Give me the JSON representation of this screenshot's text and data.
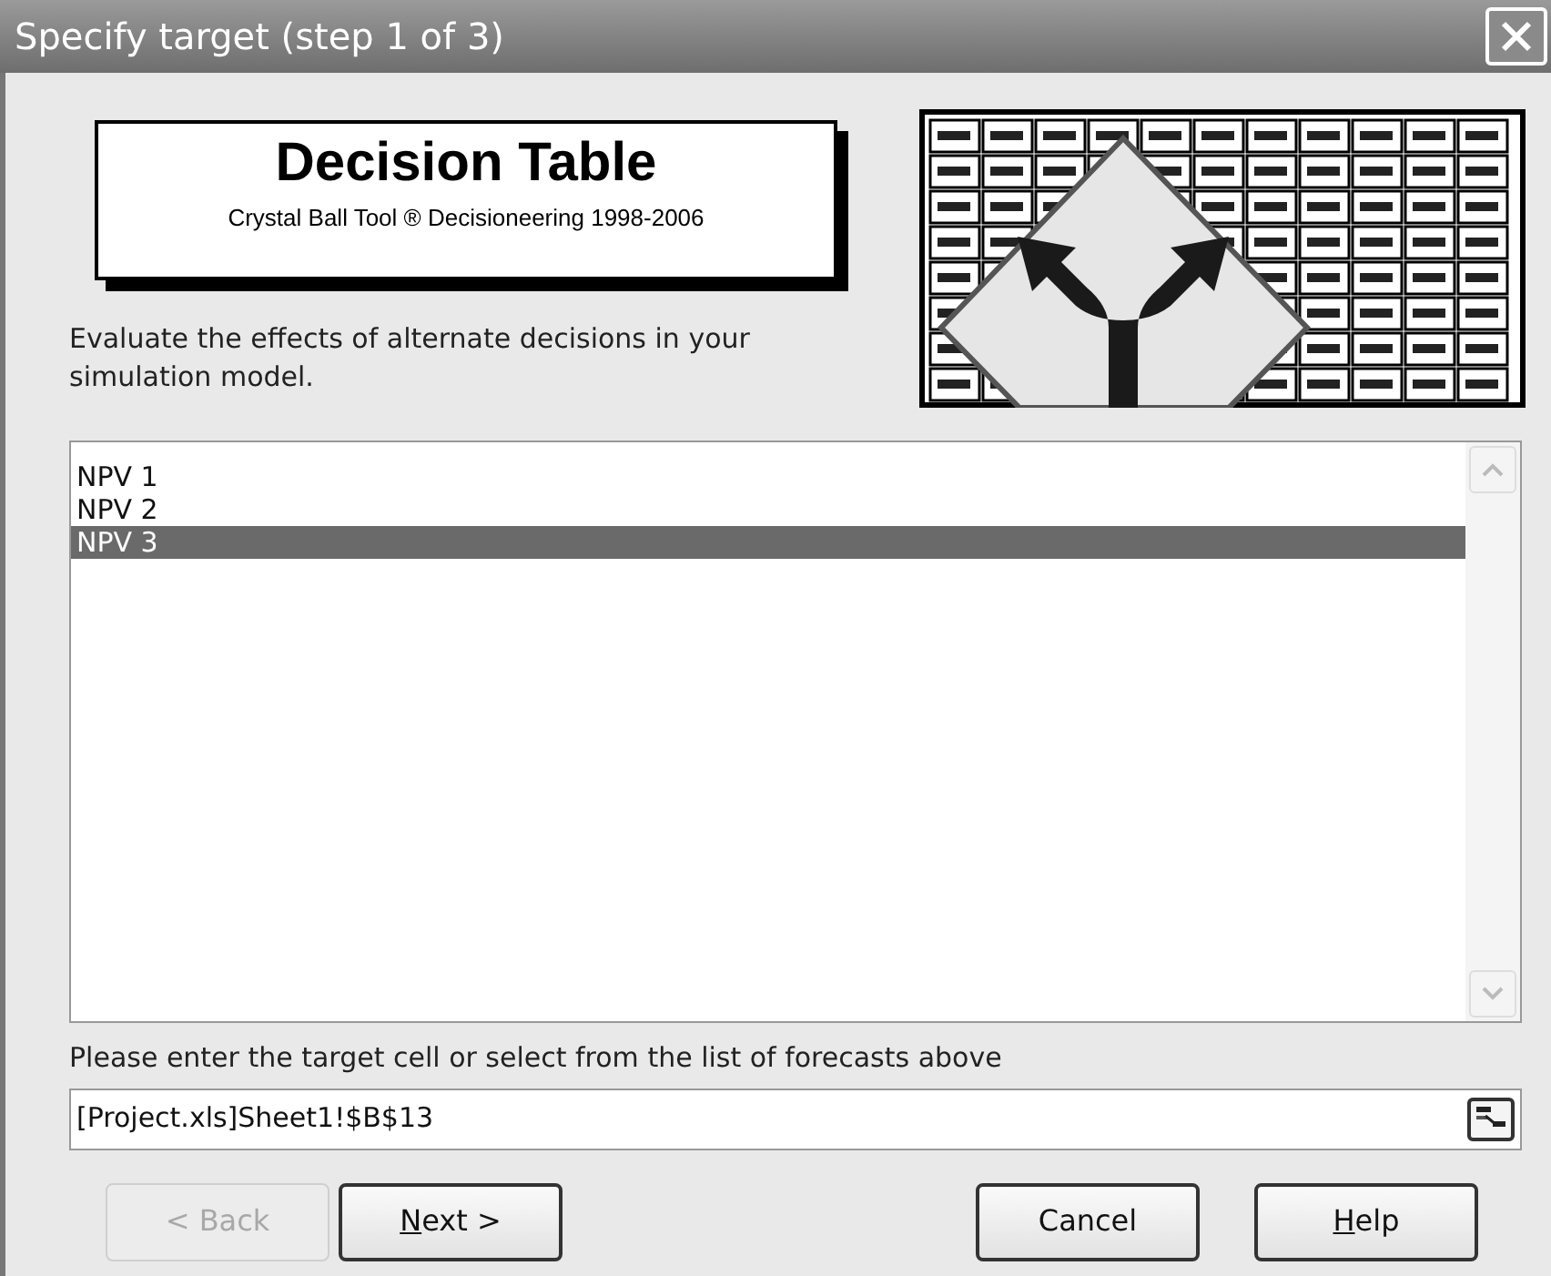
{
  "window": {
    "title": "Specify target (step 1 of 3)"
  },
  "banner": {
    "title": "Decision Table",
    "subtitle": "Crystal Ball Tool ® Decisioneering 1998-2006"
  },
  "description": "Evaluate the effects of alternate decisions in your simulation model.",
  "forecasts": [
    {
      "label": "NPV 1",
      "selected": false
    },
    {
      "label": "NPV 2",
      "selected": false
    },
    {
      "label": "NPV 3",
      "selected": true
    }
  ],
  "prompt": "Please enter the target cell or select from the list of forecasts above",
  "target_cell": {
    "value": "[Project.xls]Sheet1!$B$13"
  },
  "buttons": [
    {
      "label": "< Back",
      "disabled": true,
      "mnemonic": false
    },
    {
      "label": "Next >",
      "disabled": false,
      "mnemonic": true
    },
    {
      "label": "Cancel",
      "disabled": false,
      "mnemonic": false
    },
    {
      "label": "Help",
      "disabled": false,
      "mnemonic": true
    }
  ]
}
